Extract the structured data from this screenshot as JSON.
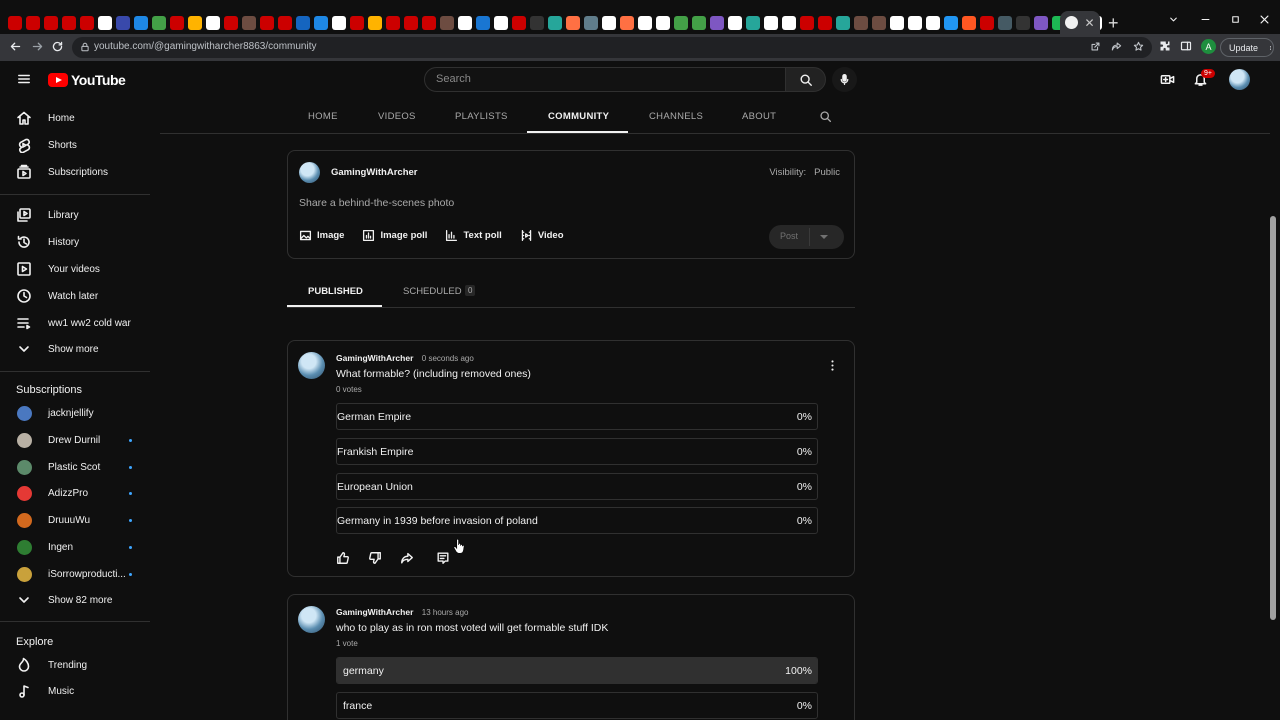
{
  "browser": {
    "url": "youtube.com/@gamingwitharcher8863/community",
    "update_label": "Update",
    "profile_initial": "A",
    "tab_close": "✕",
    "new_tab": "+",
    "tab_favicon_colors": [
      "#c00",
      "#c00",
      "#c00",
      "#c00",
      "#c00",
      "#fff",
      "#3949ab",
      "#1e88e5",
      "#43a047",
      "#c00",
      "#ffb300",
      "#fff",
      "#c00",
      "#6d4c41",
      "#c00",
      "#c00",
      "#1565c0",
      "#1e88e5",
      "#fff",
      "#c00",
      "#ffb300",
      "#c00",
      "#c00",
      "#c00",
      "#6d4c41",
      "#fff",
      "#1976d2",
      "#fff",
      "#c00",
      "#333",
      "#26a69a",
      "#ff7043",
      "#607d8b",
      "#fff",
      "#ff7043",
      "#fff",
      "#fff",
      "#43a047",
      "#43a047",
      "#7e57c2",
      "#fff",
      "#26a69a",
      "#fff",
      "#fff",
      "#c00",
      "#c00",
      "#26a69a",
      "#6d4c41",
      "#6d4c41",
      "#fff",
      "#fff",
      "#fff",
      "#2196f3",
      "#ff5722",
      "#c00",
      "#455a64",
      "#333",
      "#7e57c2",
      "#1db954",
      "#1db954",
      "#fff"
    ]
  },
  "header": {
    "brand": "YouTube",
    "search_placeholder": "Search",
    "notifications_badge": "9+"
  },
  "sidebar": {
    "main": [
      {
        "label": "Home",
        "icon": "home-icon"
      },
      {
        "label": "Shorts",
        "icon": "shorts-icon"
      },
      {
        "label": "Subscriptions",
        "icon": "subscriptions-icon"
      }
    ],
    "library": [
      {
        "label": "Library",
        "icon": "library-icon"
      },
      {
        "label": "History",
        "icon": "history-icon"
      },
      {
        "label": "Your videos",
        "icon": "your-videos-icon"
      },
      {
        "label": "Watch later",
        "icon": "clock-icon"
      },
      {
        "label": "ww1 ww2 cold war",
        "icon": "playlist-icon"
      },
      {
        "label": "Show more",
        "icon": "chevron-down-icon"
      }
    ],
    "subscriptions_heading": "Subscriptions",
    "subscriptions": [
      {
        "label": "jacknjellify",
        "color": "#4a78c0",
        "live": false
      },
      {
        "label": "Drew Durnil",
        "color": "#b8b0a4",
        "live": true
      },
      {
        "label": "Plastic Scot",
        "color": "#5c8a6a",
        "live": true
      },
      {
        "label": "AdizzPro",
        "color": "#e53935",
        "live": true
      },
      {
        "label": "DruuuWu",
        "color": "#d2691e",
        "live": true
      },
      {
        "label": "Ingen",
        "color": "#2e7d32",
        "live": true
      },
      {
        "label": "iSorrowproducti...",
        "color": "#c9a13b",
        "live": true
      }
    ],
    "show_more_subs": "Show 82 more",
    "explore_heading": "Explore",
    "explore": [
      {
        "label": "Trending",
        "icon": "trending-icon"
      },
      {
        "label": "Music",
        "icon": "music-icon"
      }
    ]
  },
  "channel_tabs": [
    "HOME",
    "VIDEOS",
    "PLAYLISTS",
    "COMMUNITY",
    "CHANNELS",
    "ABOUT"
  ],
  "create_post": {
    "channel_name": "GamingWithArcher",
    "visibility_label": "Visibility:",
    "visibility_value": "Public",
    "prompt": "Share a behind-the-scenes photo",
    "tools": [
      {
        "label": "Image",
        "icon": "image-icon"
      },
      {
        "label": "Image poll",
        "icon": "image-poll-icon"
      },
      {
        "label": "Text poll",
        "icon": "text-poll-icon"
      },
      {
        "label": "Video",
        "icon": "video-icon"
      }
    ],
    "post_label": "Post"
  },
  "post_tabs": {
    "published": "PUBLISHED",
    "scheduled": "SCHEDULED",
    "scheduled_count": "0"
  },
  "posts": [
    {
      "author": "GamingWithArcher",
      "time": "0 seconds ago",
      "text": "What formable? (including removed ones)",
      "votes": "0 votes",
      "options": [
        {
          "label": "German Empire",
          "percent": "0%",
          "fill": 0
        },
        {
          "label": "Frankish Empire",
          "percent": "0%",
          "fill": 0
        },
        {
          "label": "European Union",
          "percent": "0%",
          "fill": 0
        },
        {
          "label": "Germany in 1939 before invasion of poland",
          "percent": "0%",
          "fill": 0
        }
      ]
    },
    {
      "author": "GamingWithArcher",
      "time": "13 hours ago",
      "text": "who to play as in ron most voted will get formable stuff IDK",
      "votes": "1 vote",
      "options": [
        {
          "label": "germany",
          "percent": "100%",
          "fill": 1
        },
        {
          "label": "france",
          "percent": "0%",
          "fill": 0
        }
      ]
    }
  ]
}
